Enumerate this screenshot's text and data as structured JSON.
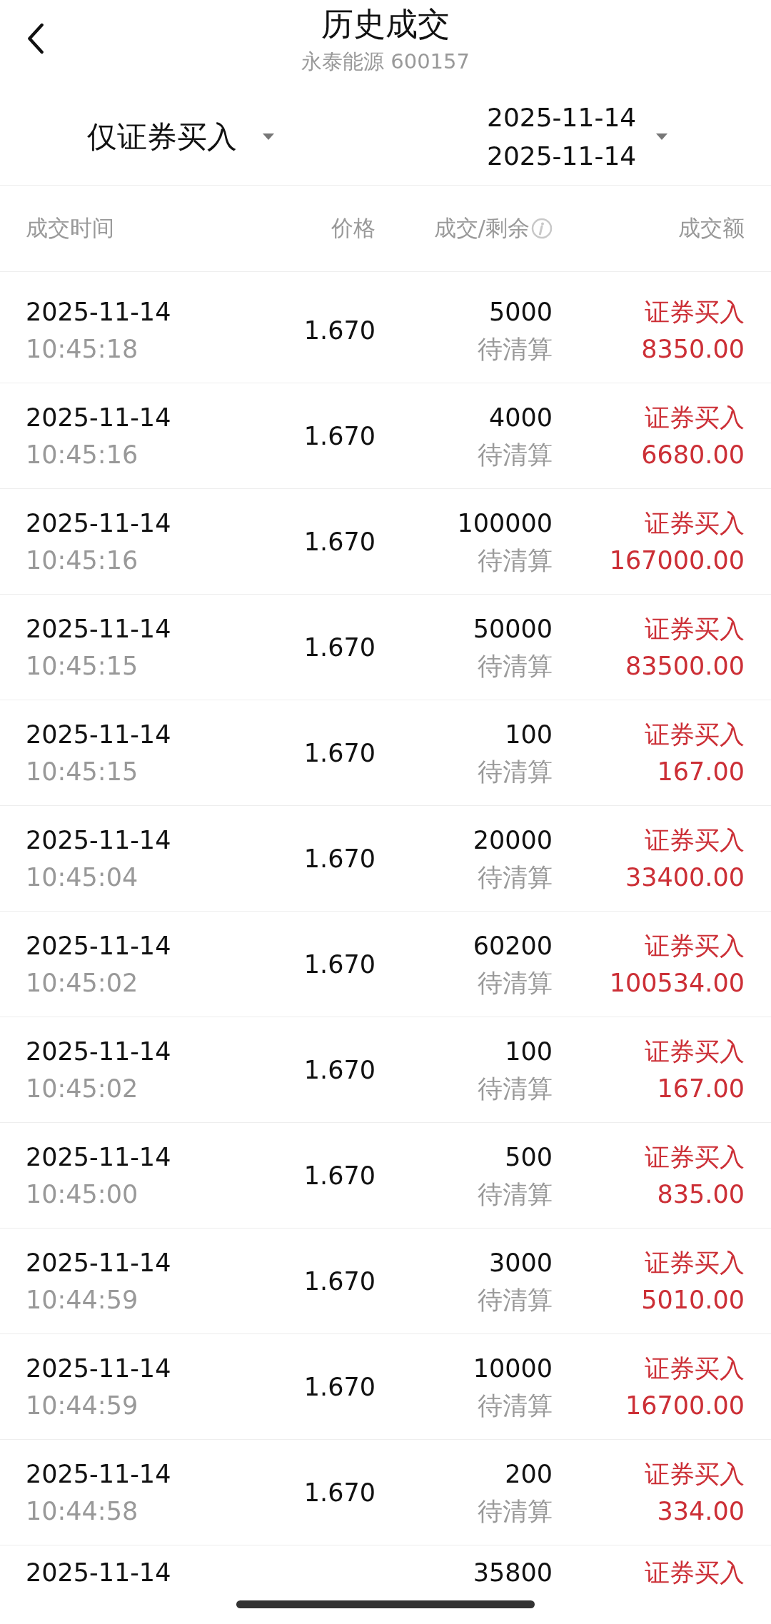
{
  "header": {
    "title": "历史成交",
    "subtitle": "永泰能源 600157"
  },
  "filters": {
    "type": "仅证券买入",
    "date_start": "2025-11-14",
    "date_end": "2025-11-14"
  },
  "table": {
    "columns": [
      "成交时间",
      "价格",
      "成交/剩余",
      "成交额"
    ],
    "rows": [
      {
        "date": "2025-11-14",
        "time": "10:45:18",
        "price": "1.670",
        "volume": "5000",
        "status": "待清算",
        "side": "证券买入",
        "amount": "8350.00"
      },
      {
        "date": "2025-11-14",
        "time": "10:45:16",
        "price": "1.670",
        "volume": "4000",
        "status": "待清算",
        "side": "证券买入",
        "amount": "6680.00"
      },
      {
        "date": "2025-11-14",
        "time": "10:45:16",
        "price": "1.670",
        "volume": "100000",
        "status": "待清算",
        "side": "证券买入",
        "amount": "167000.00"
      },
      {
        "date": "2025-11-14",
        "time": "10:45:15",
        "price": "1.670",
        "volume": "50000",
        "status": "待清算",
        "side": "证券买入",
        "amount": "83500.00"
      },
      {
        "date": "2025-11-14",
        "time": "10:45:15",
        "price": "1.670",
        "volume": "100",
        "status": "待清算",
        "side": "证券买入",
        "amount": "167.00"
      },
      {
        "date": "2025-11-14",
        "time": "10:45:04",
        "price": "1.670",
        "volume": "20000",
        "status": "待清算",
        "side": "证券买入",
        "amount": "33400.00"
      },
      {
        "date": "2025-11-14",
        "time": "10:45:02",
        "price": "1.670",
        "volume": "60200",
        "status": "待清算",
        "side": "证券买入",
        "amount": "100534.00"
      },
      {
        "date": "2025-11-14",
        "time": "10:45:02",
        "price": "1.670",
        "volume": "100",
        "status": "待清算",
        "side": "证券买入",
        "amount": "167.00"
      },
      {
        "date": "2025-11-14",
        "time": "10:45:00",
        "price": "1.670",
        "volume": "500",
        "status": "待清算",
        "side": "证券买入",
        "amount": "835.00"
      },
      {
        "date": "2025-11-14",
        "time": "10:44:59",
        "price": "1.670",
        "volume": "3000",
        "status": "待清算",
        "side": "证券买入",
        "amount": "5010.00"
      },
      {
        "date": "2025-11-14",
        "time": "10:44:59",
        "price": "1.670",
        "volume": "10000",
        "status": "待清算",
        "side": "证券买入",
        "amount": "16700.00"
      },
      {
        "date": "2025-11-14",
        "time": "10:44:58",
        "price": "1.670",
        "volume": "200",
        "status": "待清算",
        "side": "证券买入",
        "amount": "334.00"
      },
      {
        "date": "2025-11-14",
        "volume": "35800",
        "side": "证券买入"
      }
    ]
  }
}
